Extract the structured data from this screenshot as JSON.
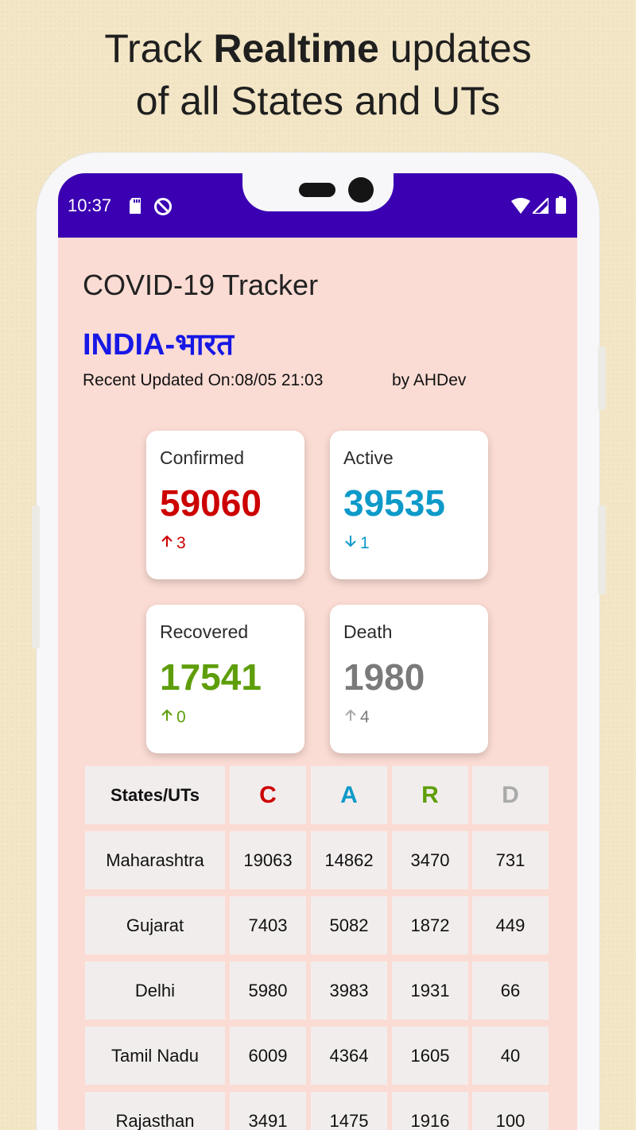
{
  "promo": {
    "line1_pre": "Track ",
    "line1_bold": "Realtime",
    "line1_post": " updates",
    "line2": "of all States and UTs"
  },
  "status_bar": {
    "time": "10:37",
    "left_icons": [
      "sd-card-icon",
      "do-not-disturb-icon"
    ],
    "right_icons": [
      "wifi-icon",
      "cell-signal-icon",
      "battery-icon"
    ],
    "color": "#3a00b2"
  },
  "app": {
    "title": "COVID-19 Tracker",
    "country": "INDIA-भारत",
    "updated": "Recent Updated On:08/05 21:03",
    "byline": "by AHDev"
  },
  "cards": [
    {
      "label": "Confirmed",
      "value": "59060",
      "delta": "3",
      "direction": "up",
      "color": "#cc0000"
    },
    {
      "label": "Active",
      "value": "39535",
      "delta": "1",
      "direction": "down",
      "color": "#0d9ac9"
    },
    {
      "label": "Recovered",
      "value": "17541",
      "delta": "0",
      "direction": "up",
      "color": "#5e9e0a"
    },
    {
      "label": "Death",
      "value": "1980",
      "delta": "4",
      "direction": "up",
      "color": "#7a7a7a"
    }
  ],
  "table": {
    "headers": [
      "States/UTs",
      "C",
      "A",
      "R",
      "D"
    ],
    "header_colors": [
      "#111111",
      "#cc0000",
      "#0d9ac9",
      "#5e9e0a",
      "#a9a9a9"
    ],
    "rows": [
      [
        "Maharashtra",
        "19063",
        "14862",
        "3470",
        "731"
      ],
      [
        "Gujarat",
        "7403",
        "5082",
        "1872",
        "449"
      ],
      [
        "Delhi",
        "5980",
        "3983",
        "1931",
        "66"
      ],
      [
        "Tamil Nadu",
        "6009",
        "4364",
        "1605",
        "40"
      ],
      [
        "Rajasthan",
        "3491",
        "1475",
        "1916",
        "100"
      ]
    ]
  }
}
